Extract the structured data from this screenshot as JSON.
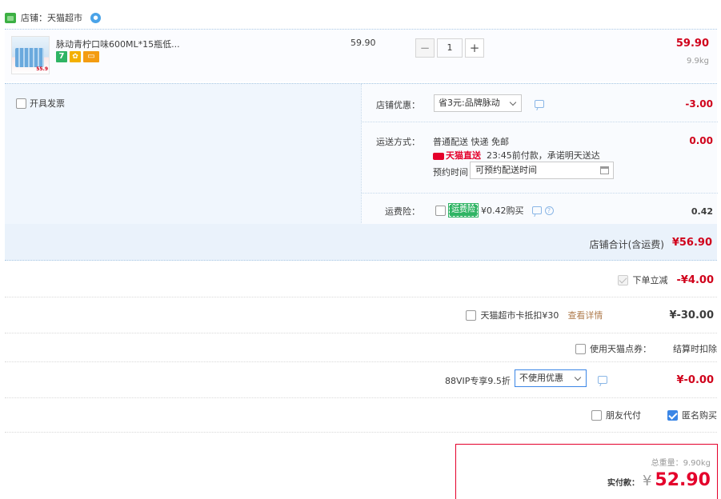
{
  "shop": {
    "name": "店铺：天猫超市",
    "icon": "shop-icon"
  },
  "product": {
    "title": "脉动青柠口味600ML*15瓶低...",
    "thumb_price_tag": "55.9",
    "badges": [
      "7"
    ],
    "unit_price": "59.90",
    "quantity": "1",
    "qty_minus": "−",
    "qty_plus": "+",
    "line_price": "59.90",
    "weight": "9.9kg"
  },
  "invoice": {
    "label": "开具发票"
  },
  "discount": {
    "label": "店铺优惠：",
    "selected": "省3元:品牌脉动",
    "value": "-3.00"
  },
  "shipping": {
    "label": "运送方式：",
    "method": "普通配送 快递 免邮",
    "tmall_brand": "天猫直送",
    "promise": "23:45前付款，承诺明天送达",
    "appointment_label": "预约时间",
    "appointment_value": "可预约配送时间",
    "value": "0.00"
  },
  "insurance": {
    "label": "运费险：",
    "tag": "运费险",
    "price": "¥0.42购买",
    "value": "0.42"
  },
  "shop_total": {
    "label": "店铺合计(含运费)",
    "value": "¥56.90"
  },
  "summary": {
    "instant_discount": {
      "label": "下单立减",
      "value": "-¥4.00"
    },
    "card": {
      "label": "天猫超市卡抵扣¥30",
      "link": "查看详情",
      "value": "¥-30.00"
    },
    "points": {
      "label": "使用天猫点券：",
      "note": "结算时扣除"
    },
    "vip": {
      "label": "88VIP专享9.5折",
      "selected": "不使用优惠",
      "value": "¥-0.00"
    },
    "friend_pay": {
      "label": "朋友代付"
    },
    "anonymous": {
      "label": "匿名购买"
    }
  },
  "final": {
    "weight_label": "总重量：9.90kg",
    "pay_label": "实付款：",
    "yen": "¥",
    "amount": "52.90"
  },
  "colors": {
    "accent_red": "#d0021b",
    "tmall_red": "#e4002b",
    "link_blue": "#3b86e6",
    "panel_blue": "#f0f6fd"
  }
}
